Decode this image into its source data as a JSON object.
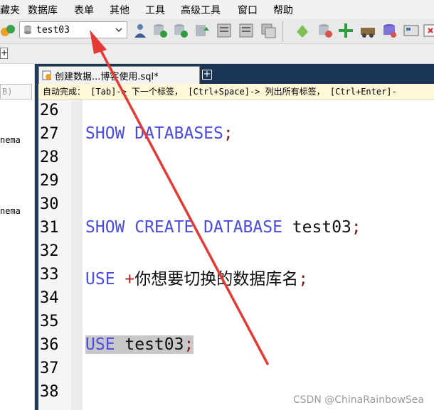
{
  "menu": {
    "items": [
      "藏夹",
      "数据库",
      "表单",
      "其他",
      "工具",
      "高级工具",
      "窗口",
      "帮助"
    ]
  },
  "toolbar": {
    "db_selector": {
      "value": "test03"
    },
    "icons": [
      "user-manager-icon",
      "backup-db-icon",
      "restore-db-icon",
      "sync-icon",
      "import-icon",
      "export-icon",
      "copy-db-icon",
      "schema-sync-icon",
      "data-sync-icon",
      "migrate-icon",
      "query-builder-icon",
      "schema-designer-icon",
      "close-window-icon"
    ]
  },
  "left_pane": {
    "search_value": "B)",
    "items": [
      "nema",
      "nema"
    ]
  },
  "editor_tab": {
    "label": "创建数据...博客使用.sql*",
    "new_tab": "+"
  },
  "hint_bar": {
    "text": "自动完成： [Tab]-> 下一个标签， [Ctrl+Space]-> 列出所有标签， [Ctrl+Enter]-"
  },
  "editor": {
    "line_numbers": [
      "26",
      "27",
      "28",
      "29",
      "30",
      "31",
      "32",
      "33",
      "34",
      "35",
      "36",
      "37",
      "38"
    ],
    "line27": {
      "kw": "SHOW DATABASES",
      "punct": ";"
    },
    "line31": {
      "kw": "SHOW CREATE DATABASE",
      "ident": " test03",
      "punct": ";"
    },
    "line33": {
      "kw": "USE ",
      "op": "+",
      "cn": "你想要切换的数据库名",
      "punct": ";"
    },
    "line36": {
      "kw": "USE",
      "ident": " test03",
      "punct": ";"
    }
  },
  "watermark": "CSDN @ChinaRainbowSea",
  "colors": {
    "keyword": "#4b4be3",
    "annotation_arrow": "#e53935",
    "tab_bar": "#1a3556"
  }
}
